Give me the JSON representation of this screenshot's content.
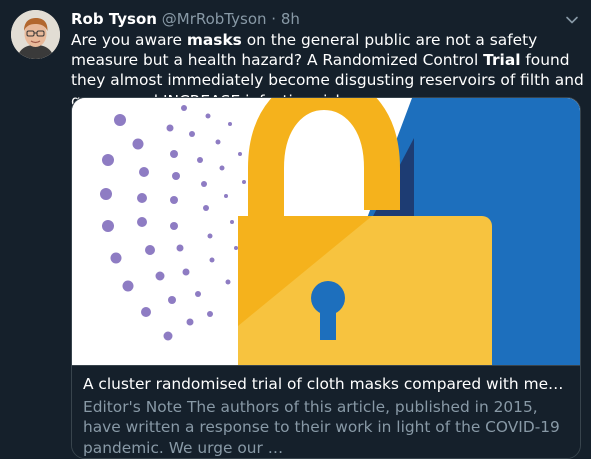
{
  "tweet": {
    "author_name": "Rob Tyson",
    "handle": "@MrRobTyson",
    "separator": "·",
    "time": "8h",
    "text_parts": [
      "Are you aware ",
      "masks",
      " on the general public are not a safety measure but a health hazard? A Randomized Control ",
      "Trial",
      " found they almost immediately become disgusting reservoirs of filth and germs, and INCREASE infection risk:"
    ]
  },
  "card": {
    "title": "A cluster randomised trial of cloth masks compared with medical masks…",
    "description": "Editor's Note The authors of this article, published in 2015, have written a response to their work in light of the COVID-19 pandemic. We urge our …"
  },
  "colors": {
    "background": "#15202b",
    "muted_text": "#8899a6",
    "border": "#38444d",
    "lock_yellow": "#f5b21c",
    "lock_yellow_light": "#f7c33f",
    "blue": "#1d6fbd",
    "navy": "#1d3c73",
    "dots_purple": "#8e7cc3"
  },
  "icons": {
    "more": "chevron-down-icon",
    "image": "padlock-keyhole-illustration"
  }
}
